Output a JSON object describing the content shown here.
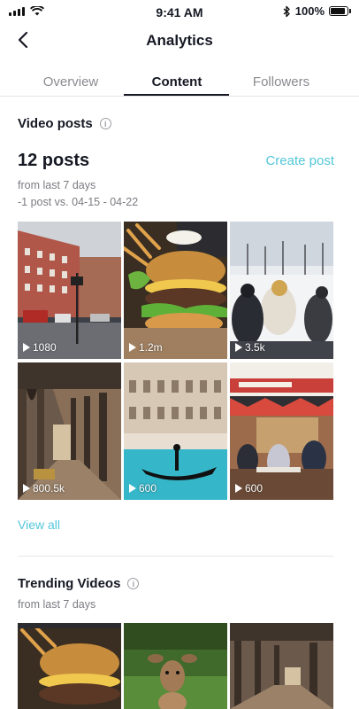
{
  "status_bar": {
    "time": "9:41 AM",
    "battery": "100%",
    "battery_level": 1.0
  },
  "header": {
    "title": "Analytics"
  },
  "tabs": [
    {
      "label": "Overview",
      "active": false
    },
    {
      "label": "Content",
      "active": true
    },
    {
      "label": "Followers",
      "active": false
    }
  ],
  "video_posts": {
    "title": "Video posts",
    "count": "12 posts",
    "create_label": "Create post",
    "subtitle1": "from last 7 days",
    "subtitle2": "-1 post vs. 04-15 - 04-22",
    "items": [
      {
        "views": "1080",
        "scene": "city street"
      },
      {
        "views": "1.2m",
        "scene": "burger"
      },
      {
        "views": "3.5k",
        "scene": "snow people"
      },
      {
        "views": "800.5k",
        "scene": "arcade corridor"
      },
      {
        "views": "600",
        "scene": "venice gondola"
      },
      {
        "views": "600",
        "scene": "cafe terrace"
      }
    ],
    "view_all": "View all"
  },
  "trending": {
    "title": "Trending Videos",
    "subtitle": "from last 7 days",
    "items": [
      {
        "scene": "burger"
      },
      {
        "scene": "deer"
      },
      {
        "scene": "arcade corridor"
      }
    ]
  },
  "colors": {
    "accent": "#53c7d9",
    "text": "#161823",
    "muted": "#7b7c82"
  }
}
